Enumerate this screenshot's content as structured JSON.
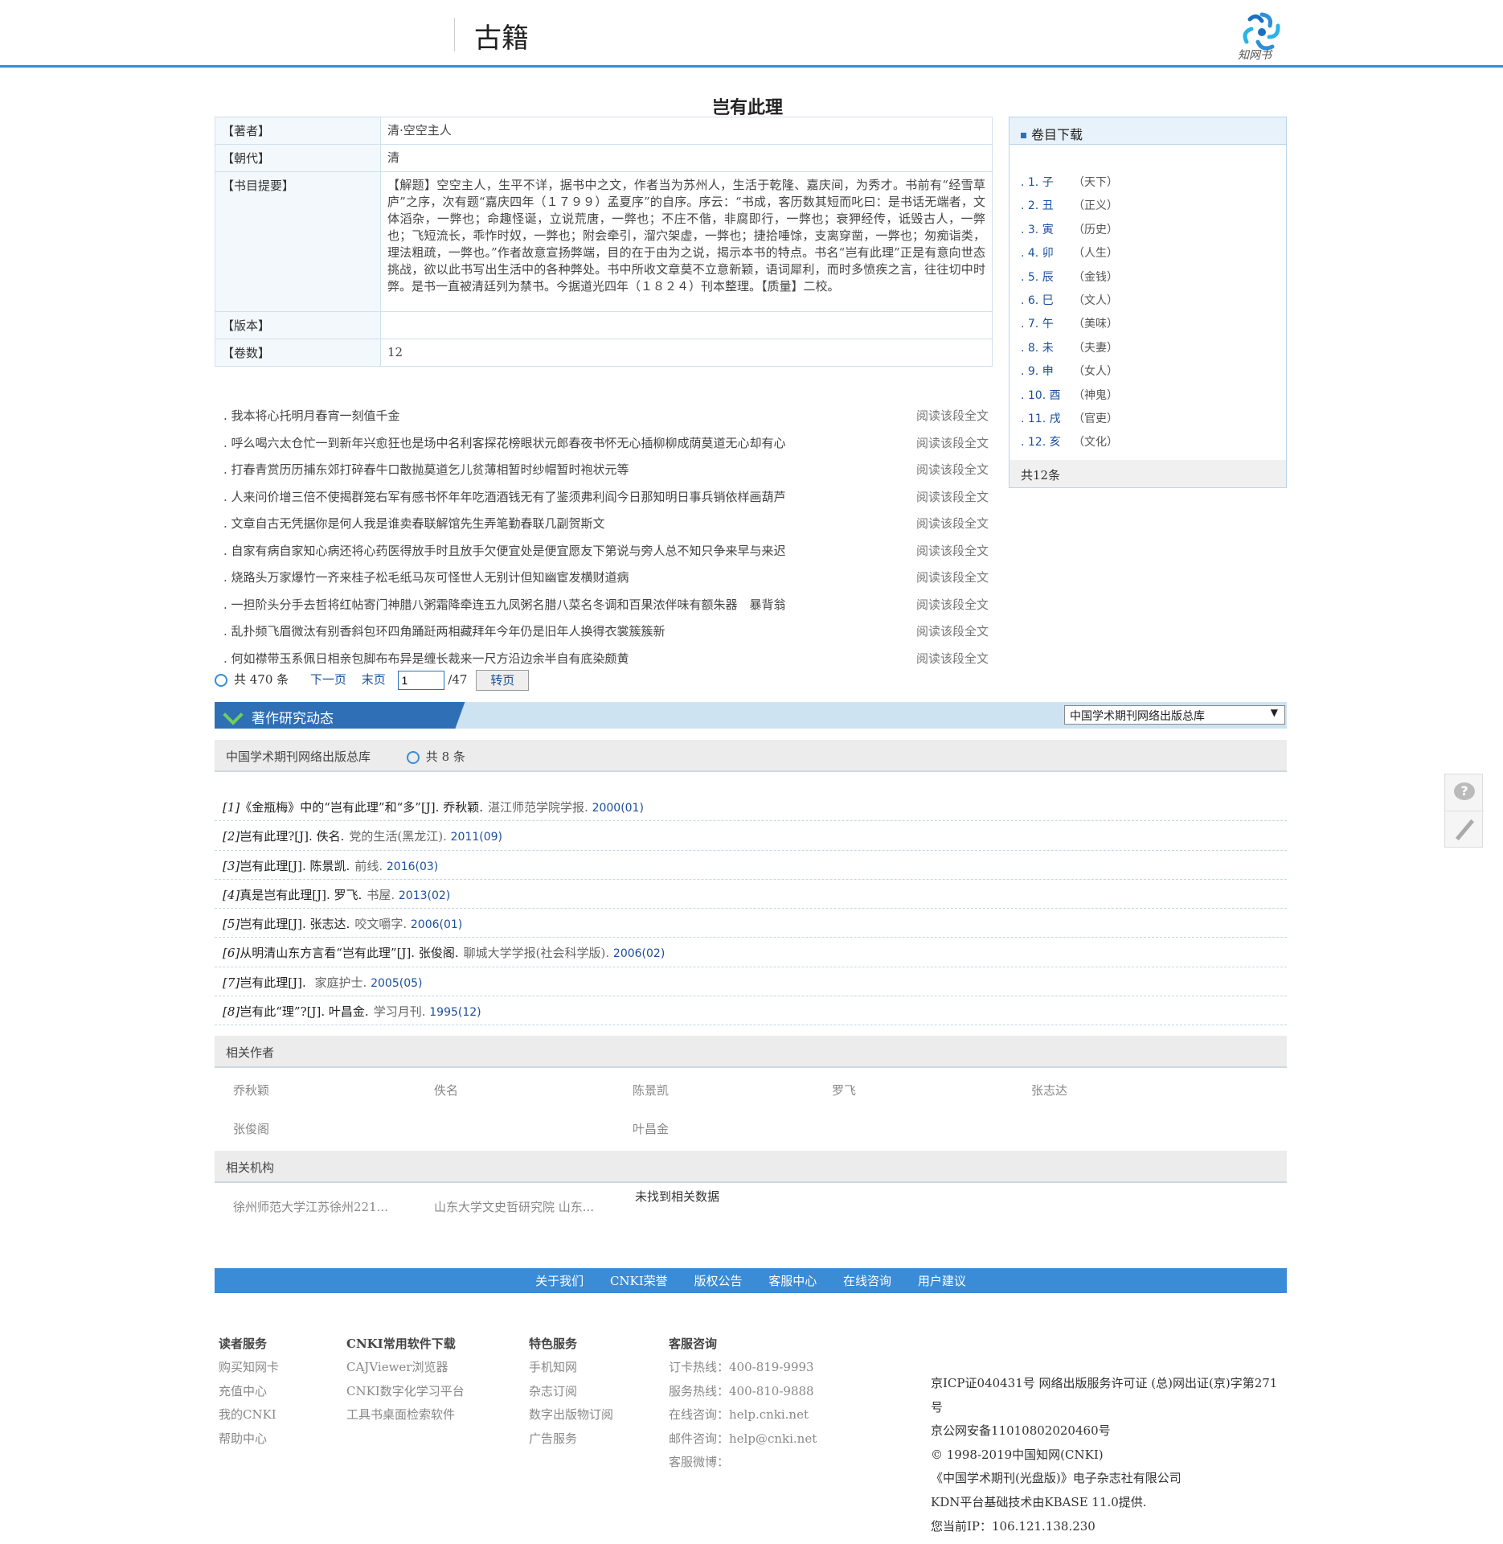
{
  "header": {
    "title": "古籍",
    "logo_text": "知网书"
  },
  "book": {
    "title": "岂有此理",
    "fields": [
      {
        "key": "【著者】",
        "value": "清·空空主人"
      },
      {
        "key": "【朝代】",
        "value": "清"
      },
      {
        "key": "【书目提要】",
        "value": "【解题】空空主人，生平不详，据书中之文，作者当为苏州人，生活于乾隆、嘉庆间，为秀才。书前有“经雪草庐”之序，次有题“嘉庆四年（１７９９）孟夏序”的自序。序云：“书成，客历数其短而叱曰：是书话无端者，文体滔杂，一弊也；命趣怪诞，立说荒唐，一弊也；不庄不偕，非腐即行，一弊也；衰狎经传，诋毁古人，一弊也；飞短流长，乖怍时奴，一弊也；附会牵引，溜穴架虚，一弊也；捷拾唾馀，支离穿凿，一弊也；匆痴诣类，理法粗疏，一弊也。”作者故意宣扬弊端，目的在于由为之说，揭示本书的特点。书名“岂有此理”正是有意向世态挑战，欲以此书写出生活中的各种弊处。书中所收文章莫不立意新颖，语词犀利，而时多愤疾之言，往往切中时弊。是书一直被清廷列为禁书。今据道光四年（１８２４）刊本整理。【质量】二校。"
      },
      {
        "key": "【版本】",
        "value": ""
      },
      {
        "key": "【卷数】",
        "value": "12"
      }
    ]
  },
  "volumes": {
    "title": "卷目下载",
    "items": [
      {
        "num": ". 1. 子",
        "name": "（天下）"
      },
      {
        "num": ". 2. 丑",
        "name": "（正义）"
      },
      {
        "num": ". 3. 寅",
        "name": "（历史）"
      },
      {
        "num": ". 4. 卯",
        "name": "（人生）"
      },
      {
        "num": ". 5. 辰",
        "name": "（金钱）"
      },
      {
        "num": ". 6. 巳",
        "name": "（文人）"
      },
      {
        "num": ". 7. 午",
        "name": "（美味）"
      },
      {
        "num": ". 8. 未",
        "name": "（夫妻）"
      },
      {
        "num": ". 9. 申",
        "name": "（女人）"
      },
      {
        "num": ". 10. 酉",
        "name": "（神鬼）"
      },
      {
        "num": ". 11. 戌",
        "name": "（官吏）"
      },
      {
        "num": ". 12. 亥",
        "name": "（文化）"
      }
    ],
    "total": "共12条"
  },
  "paragraphs": {
    "read_label": "阅读该段全文",
    "items": [
      ". 我本将心托明月春宵一刻值千金",
      ". 呼么喝六太仓忙一到新年兴愈狂也是场中名利客探花榜眼状元郎春夜书怀无心插柳柳成荫莫道无心却有心",
      ". 打春青赏历历捕东郊打碎春牛口散抛莫道乞儿贫薄相暂时纱帽暂时袍状元等",
      ". 人来问价增三倍不使揭群笼右军有感书怀年年吃酒酒钱无有了鉴须弗利阎今日那知明日事兵销依样画葫芦",
      ". 文章自古无凭据你是何人我是谁卖春联解馆先生弄笔勤春联几副贺斯文",
      ". 自家有病自家知心病还将心药医得放手时且放手欠便宜处是便宜愿友下第说与旁人总不知只争来早与来迟",
      ". 烧路头万家爆竹一齐来桂子松毛纸马灰可怪世人无别计但知幽宦发横财道病",
      ". 一担阶头分手去哲将红帖寄门神腊八粥霜降牵连五九凤粥名腊八菜名冬调和百果浓伴味有额朱器　暴背翁",
      ". 乱扑频飞眉微汰有别香斜包环四角踊跹两相藏拜年今年仍是旧年人换得衣裳簇簇新",
      ". 何如襟带玉系佩日相亲包脚布布异是缠长裁来一尺方沿边余半自有底染颇黄"
    ]
  },
  "pager": {
    "total": "共 470 条",
    "next": "下一页",
    "last": "末页",
    "page_value": "1",
    "page_total": "/47",
    "jump": "转页"
  },
  "research": {
    "tab": "著作研究动态",
    "select_value": "中国学术期刊网络出版总库",
    "source": "中国学术期刊网络出版总库",
    "count": "共 8 条",
    "items": [
      {
        "idx": "[1]",
        "title": "《金瓶梅》中的“岂有此理”和“多”",
        "type": "[J].",
        "author": "乔秋颖.",
        "journal": "湛江师范学院学报.",
        "year": "2000(01)"
      },
      {
        "idx": "[2]",
        "title": "岂有此理?",
        "type": "[J].",
        "author": "佚名.",
        "journal": "党的生活(黑龙江).",
        "year": "2011(09)"
      },
      {
        "idx": "[3]",
        "title": "岂有此理",
        "type": "[J].",
        "author": "陈景凯.",
        "journal": "前线.",
        "year": "2016(03)"
      },
      {
        "idx": "[4]",
        "title": "真是岂有此理",
        "type": "[J].",
        "author": "罗飞.",
        "journal": "书屋.",
        "year": "2013(02)"
      },
      {
        "idx": "[5]",
        "title": "岂有此理",
        "type": "[J].",
        "author": "张志达.",
        "journal": "咬文嚼字.",
        "year": "2006(01)"
      },
      {
        "idx": "[6]",
        "title": "从明清山东方言看“岂有此理”",
        "type": "[J].",
        "author": "张俊阁.",
        "journal": "聊城大学学报(社会科学版).",
        "year": "2006(02)"
      },
      {
        "idx": "[7]",
        "title": "岂有此理",
        "type": "[J].",
        "author": "",
        "journal": "家庭护士.",
        "year": "2005(05)"
      },
      {
        "idx": "[8]",
        "title": "岂有此“理”?",
        "type": "[J].",
        "author": "叶昌金.",
        "journal": "学习月刊.",
        "year": "1995(12)"
      }
    ]
  },
  "related_authors": {
    "title": "相关作者",
    "items": [
      "乔秋颖",
      "佚名",
      "陈景凯",
      "罗飞",
      "张志达",
      "张俊阁",
      "叶昌金"
    ]
  },
  "related_orgs": {
    "title": "相关机构",
    "items": [
      "徐州师范大学江苏徐州221...",
      "山东大学文史哲研究院 山东..."
    ],
    "nodata": "未找到相关数据"
  },
  "footer": {
    "nav": [
      "关于我们",
      "CNKI荣誉",
      "版权公告",
      "客服中心",
      "在线咨询",
      "用户建议"
    ],
    "col1": {
      "title": "读者服务",
      "items": [
        "购买知网卡",
        "充值中心",
        "我的CNKI",
        "帮助中心"
      ]
    },
    "col2": {
      "title": "CNKI常用软件下载",
      "items": [
        "CAJViewer浏览器",
        "CNKI数字化学习平台",
        "工具书桌面检索软件"
      ]
    },
    "col3": {
      "title": "特色服务",
      "items": [
        "手机知网",
        "杂志订阅",
        "数字出版物订阅",
        "广告服务"
      ]
    },
    "col4": {
      "title": "客服咨询",
      "items": [
        "订卡热线：400-819-9993",
        "服务热线：400-810-9888",
        "在线咨询：help.cnki.net",
        "邮件咨询：help@cnki.net",
        "客服微博："
      ]
    },
    "right": [
      "京ICP证040431号 网络出版服务许可证 (总)网出证(京)字第271",
      "号",
      "京公网安备11010802020460号",
      "© 1998-2019中国知网(CNKI)",
      "《中国学术期刊(光盘版)》电子杂志社有限公司",
      "KDN平台基础技术由KBASE 11.0提供.",
      "您当前IP：106.121.138.230"
    ]
  }
}
